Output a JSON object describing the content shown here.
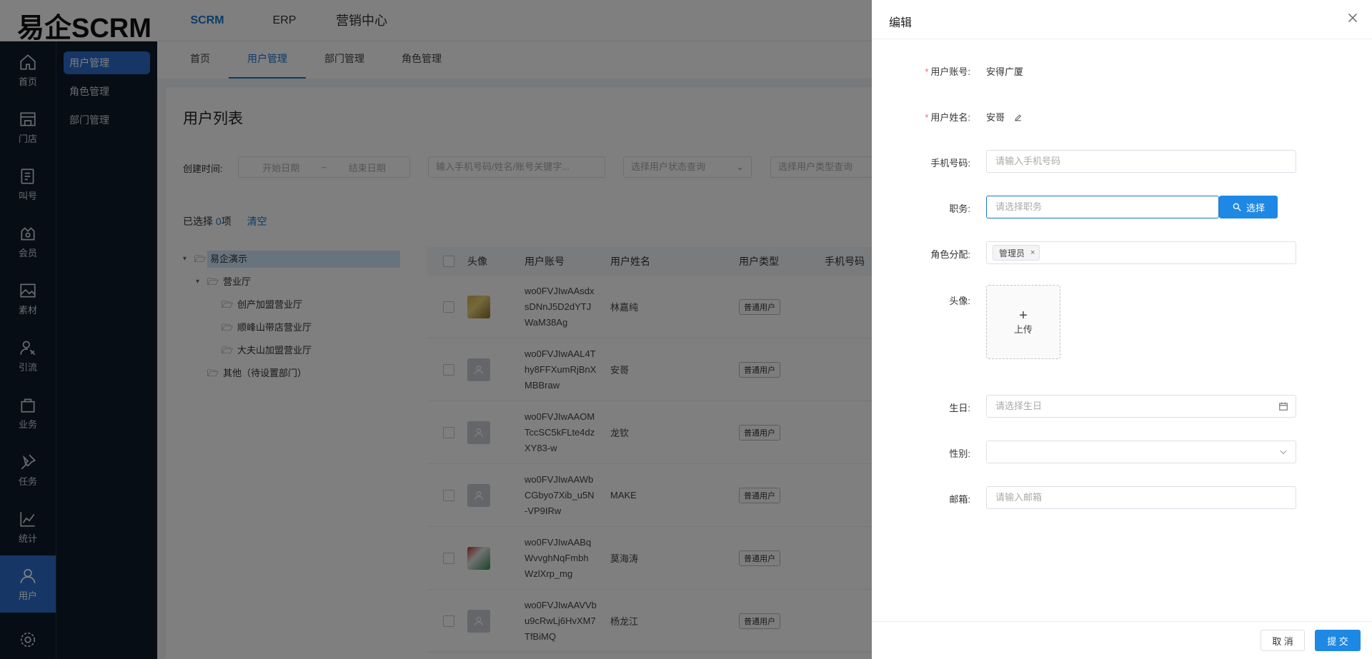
{
  "app": {
    "logo": "易企SCRM"
  },
  "topnav": [
    {
      "label": "SCRM"
    },
    {
      "label": "ERP"
    },
    {
      "label": "营销中心"
    }
  ],
  "rail": [
    {
      "label": "首页",
      "icon": "home-icon"
    },
    {
      "label": "门店",
      "icon": "store-icon"
    },
    {
      "label": "叫号",
      "icon": "ticket-icon"
    },
    {
      "label": "会员",
      "icon": "member-icon"
    },
    {
      "label": "素材",
      "icon": "image-icon"
    },
    {
      "label": "引流",
      "icon": "traffic-icon"
    },
    {
      "label": "业务",
      "icon": "bag-icon"
    },
    {
      "label": "任务",
      "icon": "pin-icon"
    },
    {
      "label": "统计",
      "icon": "chart-icon"
    },
    {
      "label": "用户",
      "icon": "user-icon"
    },
    {
      "label": "",
      "icon": "gear-icon"
    }
  ],
  "submenu": [
    {
      "label": "用户管理"
    },
    {
      "label": "角色管理"
    },
    {
      "label": "部门管理"
    }
  ],
  "tabs": [
    {
      "label": "首页"
    },
    {
      "label": "用户管理"
    },
    {
      "label": "部门管理"
    },
    {
      "label": "角色管理"
    }
  ],
  "main": {
    "title": "用户列表",
    "filters": {
      "created_label": "创建时间:",
      "start_placeholder": "开始日期",
      "range_sep": "~",
      "end_placeholder": "结束日期",
      "keyword_placeholder": "输入手机号码/姓名/账号关键字...",
      "status_placeholder": "选择用户状态查询",
      "type_placeholder": "选择用户类型查询"
    },
    "selection": {
      "prefix": "已选择 ",
      "count": "0",
      "suffix": "项",
      "clear": "清空"
    },
    "tree": [
      {
        "label": "易企演示",
        "level": 0,
        "caret": "▾"
      },
      {
        "label": "营业厅",
        "level": 1,
        "caret": "▾"
      },
      {
        "label": "创产加盟营业厅",
        "level": 2,
        "caret": ""
      },
      {
        "label": "顺峰山带店营业厅",
        "level": 2,
        "caret": ""
      },
      {
        "label": "大夫山加盟营业厅",
        "level": 2,
        "caret": ""
      },
      {
        "label": "其他（待设置部门）",
        "level": 1,
        "caret": ""
      }
    ],
    "table": {
      "headers": [
        "头像",
        "用户账号",
        "用户姓名",
        "用户类型",
        "手机号码"
      ],
      "rows": [
        {
          "acct": [
            "wo0FVJIwAAsdx",
            "sDNnJ5D2dYTJ",
            "WaM38Ag"
          ],
          "name": "林嘉纯",
          "type": "普通用户",
          "avatar": "photo1"
        },
        {
          "acct": [
            "wo0FVJIwAAL4T",
            "hy8FFXumRjBnX",
            "MBBraw"
          ],
          "name": "安哥",
          "type": "普通用户",
          "avatar": "default"
        },
        {
          "acct": [
            "wo0FVJIwAAOM",
            "TccSC5kFLte4dz",
            "XY83-w"
          ],
          "name": "龙钦",
          "type": "普通用户",
          "avatar": "default"
        },
        {
          "acct": [
            "wo0FVJIwAAWb",
            "CGbyo7Xib_u5N",
            "-VP9IRw"
          ],
          "name": "MAKE",
          "type": "普通用户",
          "avatar": "default"
        },
        {
          "acct": [
            "wo0FVJIwAABq",
            "WvvghNqFmbh",
            "WzlXrp_mg"
          ],
          "name": "莫海涛",
          "type": "普通用户",
          "avatar": "photo2"
        },
        {
          "acct": [
            "wo0FVJIwAAVVb",
            "u9cRwLj6HvXM7",
            "TfBiMQ"
          ],
          "name": "杨龙江",
          "type": "普通用户",
          "avatar": "default"
        }
      ]
    }
  },
  "drawer": {
    "title": "编辑",
    "fields": {
      "account": {
        "label": "用户账号:",
        "value": "安得广厦"
      },
      "name": {
        "label": "用户姓名:",
        "value": "安哥"
      },
      "phone": {
        "label": "手机号码:",
        "placeholder": "请输入手机号码"
      },
      "job": {
        "label": "职务:",
        "placeholder": "请选择职务",
        "button": "选择"
      },
      "role": {
        "label": "角色分配:",
        "tag": "管理员",
        "tag_remove": "×"
      },
      "avatar": {
        "label": "头像:",
        "plus": "+",
        "upload": "上传"
      },
      "birthday": {
        "label": "生日:",
        "placeholder": "请选择生日"
      },
      "gender": {
        "label": "性别:",
        "value": ""
      },
      "email": {
        "label": "邮箱:",
        "placeholder": "请输入邮箱"
      }
    },
    "footer": {
      "cancel": "取 消",
      "submit": "提 交"
    }
  },
  "colors": {
    "accent": "#1e88e5",
    "sidebar": "#0e1a2b",
    "active_menu": "#2d6fcc",
    "required": "#f56c6c"
  }
}
